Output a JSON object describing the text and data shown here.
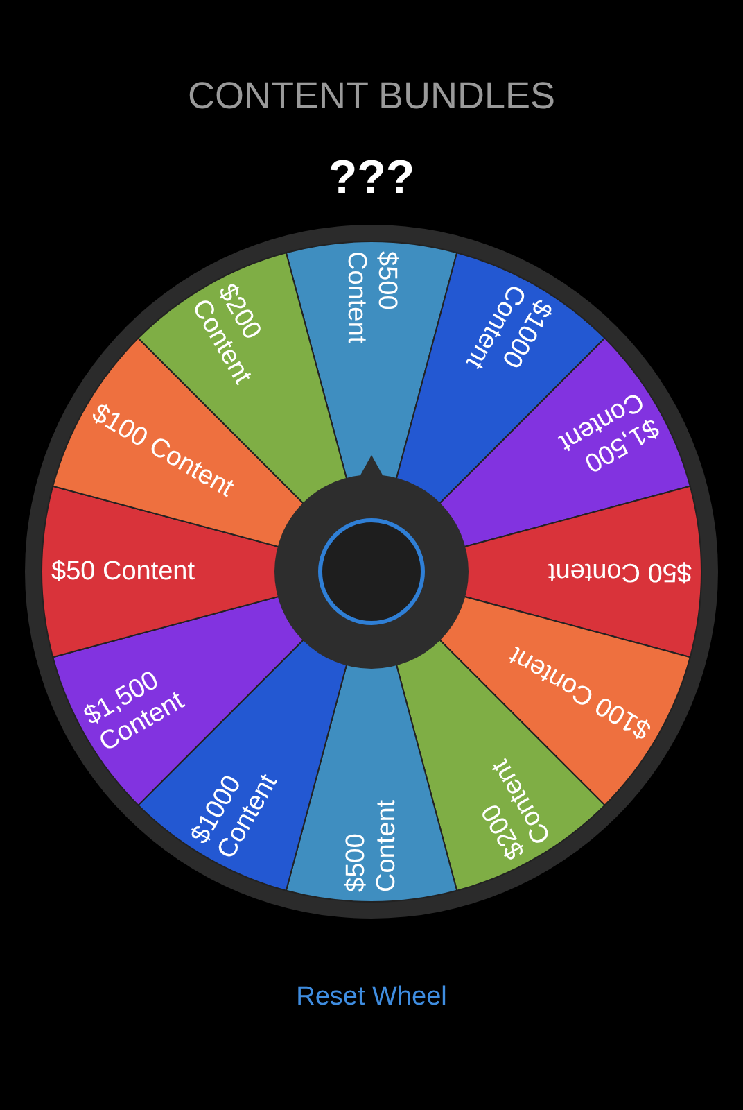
{
  "title": "CONTENT BUNDLES",
  "subtitle": "???",
  "wheel": {
    "segments": [
      {
        "lines": [
          "$500",
          "Content"
        ],
        "color": "#3f8ec0"
      },
      {
        "lines": [
          "$1000",
          "Content"
        ],
        "color": "#2358d2"
      },
      {
        "lines": [
          "$1,500",
          "Content"
        ],
        "color": "#8233e0"
      },
      {
        "lines": [
          "$50 Content"
        ],
        "color": "#d9333a"
      },
      {
        "lines": [
          "$100 Content"
        ],
        "color": "#ee703f"
      },
      {
        "lines": [
          "$200",
          "Content"
        ],
        "color": "#7fae45"
      },
      {
        "lines": [
          "$500",
          "Content"
        ],
        "color": "#3f8ec0"
      },
      {
        "lines": [
          "$1000",
          "Content"
        ],
        "color": "#2358d2"
      },
      {
        "lines": [
          "$1,500",
          "Content"
        ],
        "color": "#8233e0"
      },
      {
        "lines": [
          "$50 Content"
        ],
        "color": "#d9333a"
      },
      {
        "lines": [
          "$100 Content"
        ],
        "color": "#ee703f"
      },
      {
        "lines": [
          "$200",
          "Content"
        ],
        "color": "#7fae45"
      }
    ]
  },
  "reset_button": "Reset Wheel"
}
